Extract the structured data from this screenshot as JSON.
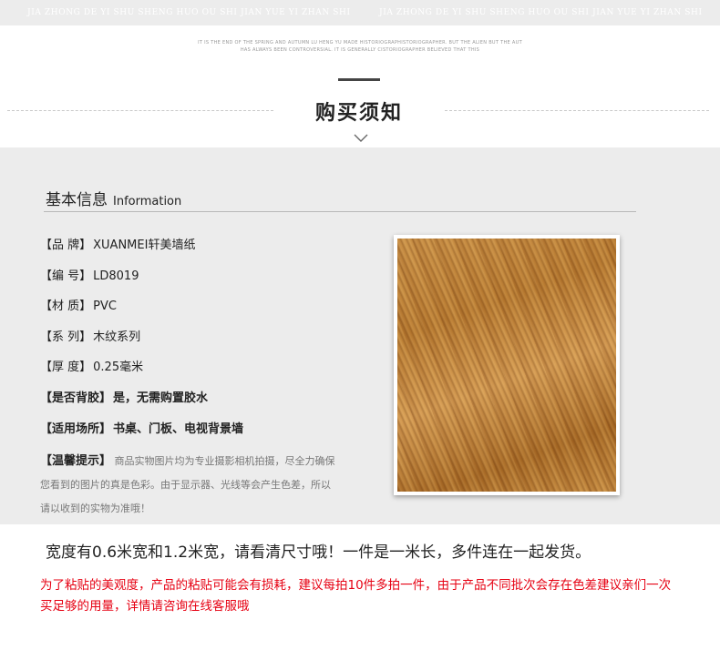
{
  "header": {
    "band_text_left": "JIA ZHONG DE YI SHU SHENG HUO OU SHI JIAN YUE YI ZHAN SHI",
    "band_text_right": "JIA ZHONG DE YI SHU SHENG HUO OU SHI JIAN YUE YI ZHAN SHI",
    "fine_print_line1": "IT IS THE END OF THE SPRING AND AUTUMN LU HENG YU MADE HISTORIOGRAPHISTORIOGRAPHER. BUT THE ALIEN BUT THE AUT",
    "fine_print_line2": "HAS ALWAYS BEEN CONTROVERSIAL. IT IS GENERALLY CISTORIOGRAPHER BELIEVED THAT THIS",
    "title": "购买须知"
  },
  "info": {
    "section_title": "基本信息",
    "section_subtitle": "Information",
    "rows": [
      {
        "label": "【品  牌】",
        "value": "XUANMEI轩美墙纸"
      },
      {
        "label": "【编  号】",
        "value": "LD8019"
      },
      {
        "label": "【材  质】",
        "value": "PVC"
      },
      {
        "label": "【系  列】",
        "value": "木纹系列"
      },
      {
        "label": "【厚  度】",
        "value": "0.25毫米"
      },
      {
        "label": "【是否背胶】",
        "value": "是，无需购置胶水"
      },
      {
        "label": "【适用场所】",
        "value": "书桌、门板、电视背景墙"
      }
    ],
    "tip_label": "【温馨提示】",
    "tip_text": "商品实物图片均为专业摄影相机拍摄，尽全力确保您看到的图片的真是色彩。由于显示器、光线等会产生色差，所以请以收到的实物为准哦！"
  },
  "notes": {
    "size_note": "宽度有0.6米宽和1.2米宽，请看清尺寸哦！一件是一米长，多件连在一起发货。",
    "warning": "为了粘贴的美观度，产品的粘贴可能会有损耗，建议每拍10件多拍一件，由于产品不同批次会存在色差建议亲们一次买足够的用量，详情请咨询在线客服哦",
    "warning_color": "#e60012"
  },
  "icons": {
    "divider_chevron": "chevron-down-icon"
  }
}
